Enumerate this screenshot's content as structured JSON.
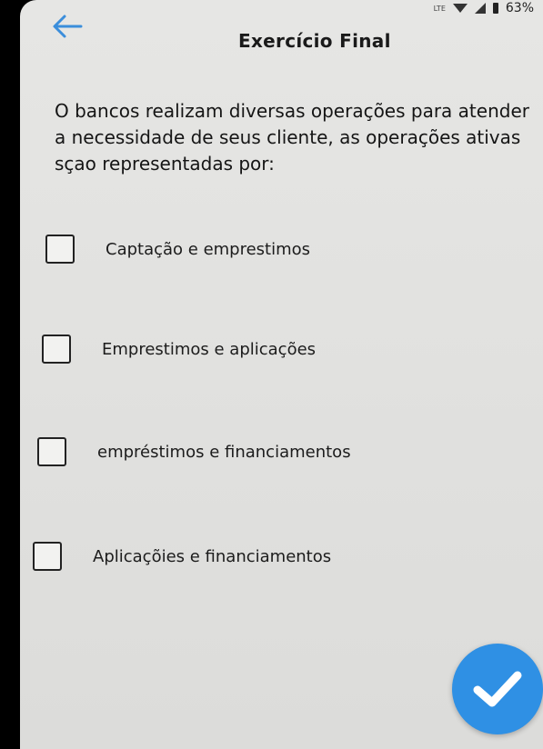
{
  "status_bar": {
    "network": "LTE",
    "battery": "63%"
  },
  "header": {
    "title": "Exercício Final",
    "back_icon": "arrow-left-icon"
  },
  "question": {
    "text": "O bancos realizam diversas operações para atender a necessidade de seus cliente, as operações ativas sçao representadas por:"
  },
  "options": [
    {
      "label": "Captação e emprestimos",
      "checked": false
    },
    {
      "label": "Emprestimos e aplicações",
      "checked": false
    },
    {
      "label": "empréstimos e financiamentos",
      "checked": false
    },
    {
      "label": "Aplicaçõies e financiamentos",
      "checked": false
    }
  ],
  "submit": {
    "icon": "checkmark-icon"
  },
  "colors": {
    "accent": "#2f90e4",
    "back_arrow": "#3b8edb"
  }
}
